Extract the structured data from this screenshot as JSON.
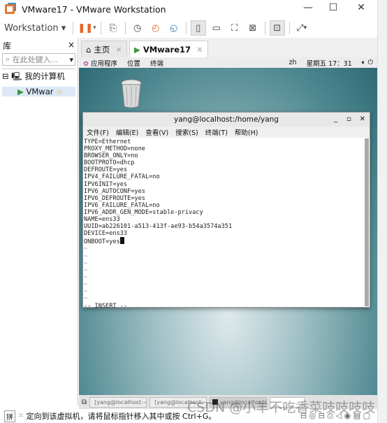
{
  "window": {
    "title": "VMware17 - VMware Workstation",
    "min": "—",
    "max": "☐",
    "close": "✕"
  },
  "toolbar": {
    "menu_label": "Workstation"
  },
  "library": {
    "title": "库",
    "close": "×",
    "search_placeholder": "在此处键入...",
    "root": "我的计算机",
    "vm": "VMwar"
  },
  "tabs": [
    {
      "label": "主页"
    },
    {
      "label": "VMware17"
    }
  ],
  "gnome": {
    "apps": "应用程序",
    "places": "位置",
    "terminal": "终端",
    "lang": "zh",
    "clock": "星期五 17：31"
  },
  "terminal": {
    "title": "yang@localhost:/home/yang",
    "menu": [
      "文件(F)",
      "编辑(E)",
      "查看(V)",
      "搜索(S)",
      "终端(T)",
      "帮助(H)"
    ],
    "lines": [
      "TYPE=Ethernet",
      "PROXY_METHOD=none",
      "BROWSER_ONLY=no",
      "BOOTPROTO=dhcp",
      "DEFROUTE=yes",
      "IPV4_FAILURE_FATAL=no",
      "IPV6INIT=yes",
      "IPV6_AUTOCONF=yes",
      "IPV6_DEFROUTE=yes",
      "IPV6_FAILURE_FATAL=no",
      "IPV6_ADDR_GEN_MODE=stable-privacy",
      "NAME=ens33",
      "UUID=ab226101-a513-413f-ae93-b54a3574a351",
      "DEVICE=ens33",
      "ONBOOT=yes"
    ],
    "mode": "-- INSERT --"
  },
  "taskbar": [
    "[yang@localhost:~",
    "[yang@localhost:~]",
    "yang@localhost:"
  ],
  "status": {
    "ime": "拼",
    "message": "定向到该虚拟机，请将鼠标指针移入其中或按 Ctrl+G。"
  },
  "watermark": "CSDN @小羊不吃香菜吱吱吱吱"
}
